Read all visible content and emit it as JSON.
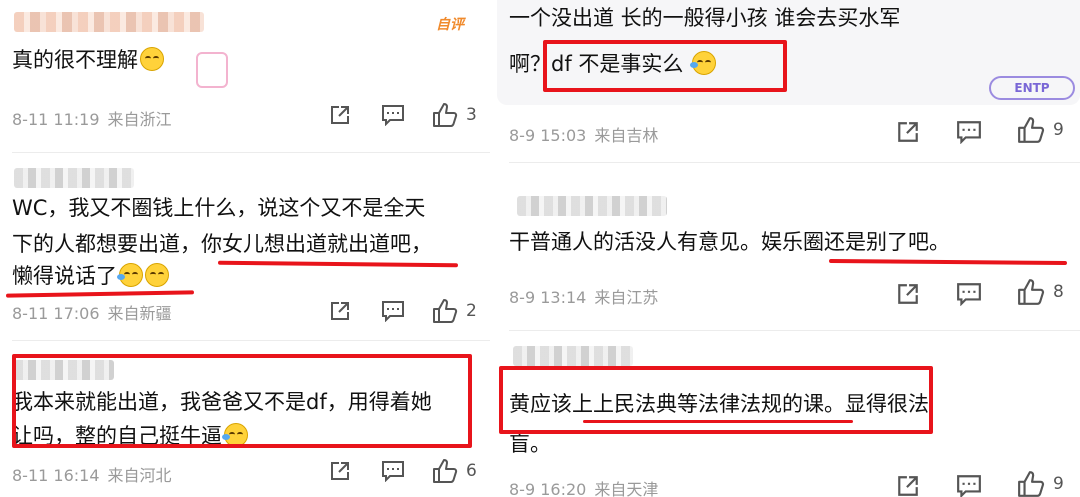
{
  "left": {
    "comments": [
      {
        "badge": "自评",
        "text_lines": [
          "真的很不理解"
        ],
        "time": "8-11 11:19",
        "location": "来自浙江",
        "likes": "3"
      },
      {
        "text_lines": [
          "WC，我又不圈钱上什么，说这个又不是全天",
          "下的人都想要出道，你女儿想出道就出道吧，",
          "懒得说话了"
        ],
        "time": "8-11 17:06",
        "location": "来自新疆",
        "likes": "2"
      },
      {
        "text_lines": [
          "我本来就能出道，我爸爸又不是df，用得着她",
          "让吗，整的自己挺牛逼"
        ],
        "time": "8-11 16:14",
        "location": "来自河北",
        "likes": "6"
      }
    ]
  },
  "right": {
    "comments": [
      {
        "text_lines": [
          "一个没出道 长的一般得小孩 谁会去买水军",
          "啊？df 不是事实么"
        ],
        "time": "8-9 15:03",
        "location": "来自吉林",
        "likes": "9",
        "sticker": "ENTP"
      },
      {
        "text_lines": [
          "干普通人的活没人有意见。娱乐圈还是别了吧。"
        ],
        "time": "8-9 13:14",
        "location": "来自江苏",
        "likes": "8"
      },
      {
        "text_lines": [
          "黄应该上上民法典等法律法规的课。显得很法",
          "盲。"
        ],
        "time": "8-9 16:20",
        "location": "来自天津",
        "likes": "9"
      }
    ]
  },
  "icons": {
    "share": "share-icon",
    "comment": "comment-icon",
    "like": "thumbs-up-icon"
  },
  "colors": {
    "highlight": "#e8141b",
    "meta": "#9a9a9a",
    "badge": "#f08a2c"
  }
}
